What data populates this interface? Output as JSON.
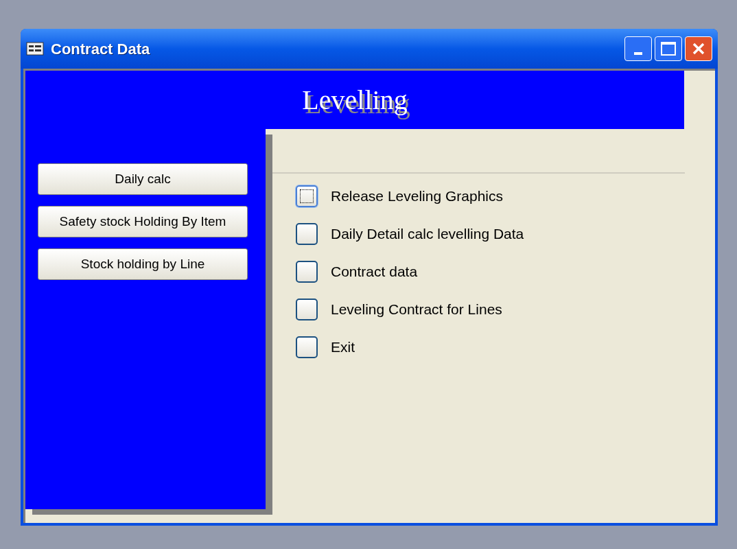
{
  "window": {
    "title": "Contract Data"
  },
  "header": {
    "title": "Levelling"
  },
  "side_buttons": [
    {
      "label": "Daily calc",
      "focused": false
    },
    {
      "label": "Safety stock Holding By Item",
      "focused": false
    },
    {
      "label": "Stock holding by Line",
      "focused": false
    }
  ],
  "options": [
    {
      "label": "Release Leveling Graphics",
      "focused": true
    },
    {
      "label": "Daily Detail calc levelling Data",
      "focused": false
    },
    {
      "label": "Contract data",
      "focused": false
    },
    {
      "label": "Leveling Contract for Lines",
      "focused": false
    },
    {
      "label": "Exit",
      "focused": false
    }
  ]
}
